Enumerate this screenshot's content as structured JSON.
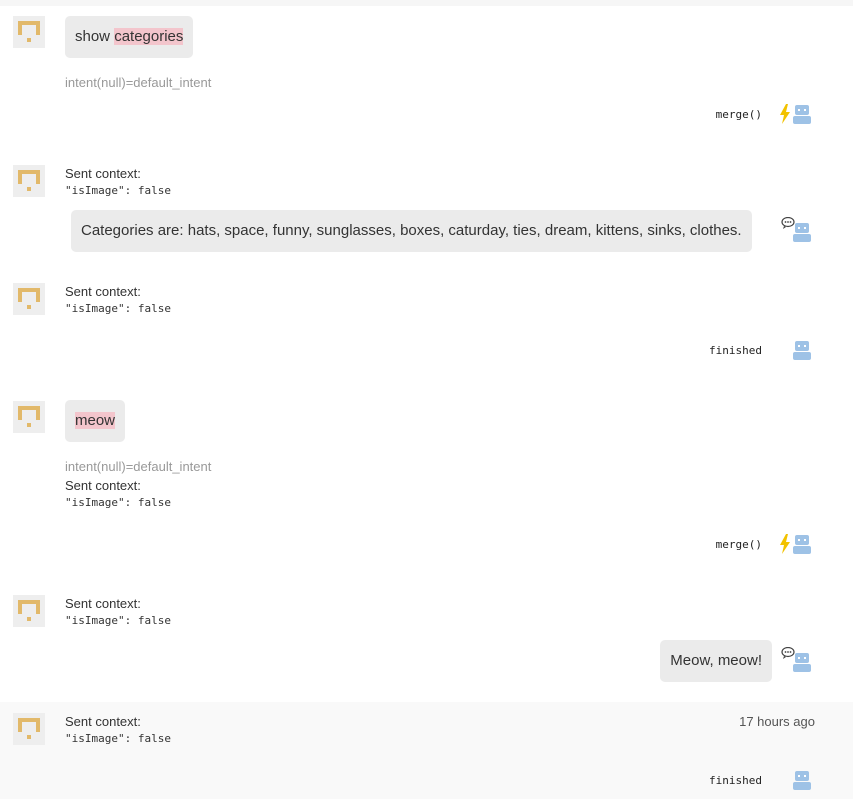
{
  "messages": {
    "m1": {
      "text_plain": "show ",
      "text_highlight": "categories",
      "intent": "intent(null)=default_intent",
      "action": "merge()"
    },
    "m2": {
      "context_label": "Sent context:",
      "context_value": "\"isImage\": false",
      "reply": "Categories are: hats, space, funny, sunglasses, boxes, caturday, ties, dream, kittens, sinks, clothes."
    },
    "m3": {
      "context_label": "Sent context:",
      "context_value": "\"isImage\": false",
      "action": "finished"
    },
    "m4": {
      "text_highlight": "meow",
      "intent": "intent(null)=default_intent",
      "context_label": "Sent context:",
      "context_value": "\"isImage\": false",
      "action": "merge()"
    },
    "m5": {
      "context_label": "Sent context:",
      "context_value": "\"isImage\": false",
      "reply": "Meow, meow!"
    },
    "m6": {
      "context_label": "Sent context:",
      "context_value": "\"isImage\": false",
      "time": "17 hours ago",
      "action": "finished"
    }
  },
  "colors": {
    "avatar_gold": "#e2b96a",
    "bot_blue": "#9ec2e6",
    "flash_yellow": "#f2c200",
    "highlight": "#f3c5cc"
  },
  "icons": {
    "user_avatar": "user-avatar-icon",
    "bot": "robot-icon",
    "flash": "flash-icon",
    "chat": "speech-bubble-icon"
  }
}
